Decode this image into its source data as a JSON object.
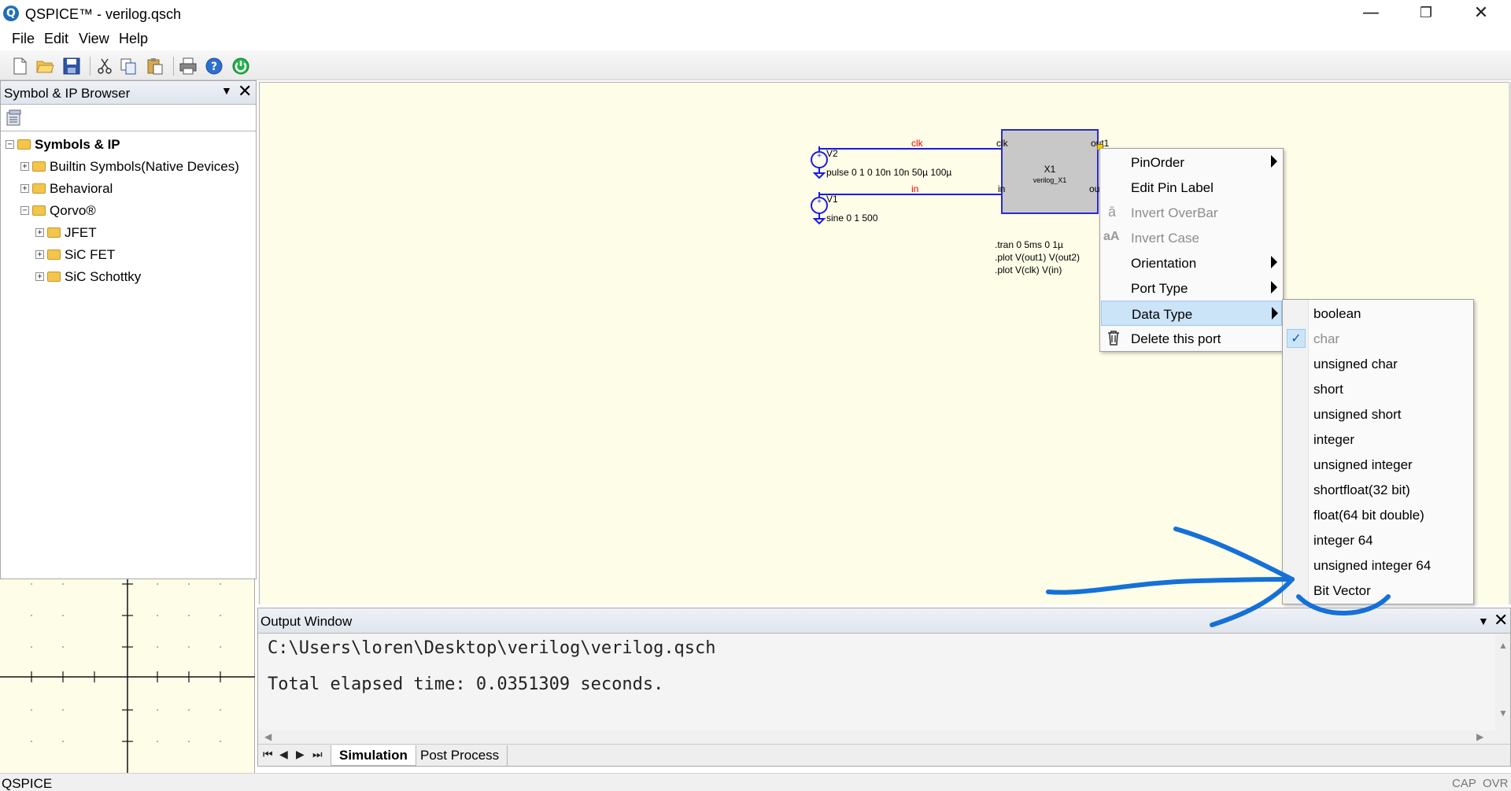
{
  "window": {
    "title": "QSPICE™ - verilog.qsch",
    "logo": "Q",
    "minimize": "—",
    "maximize": "❐",
    "close": "✕"
  },
  "menu": [
    "File",
    "Edit",
    "View",
    "Help"
  ],
  "toolbar": [
    "new-file-icon",
    "open-folder-icon",
    "save-icon",
    "cut-icon",
    "copy-icon",
    "paste-icon",
    "print-icon",
    "help-icon",
    "power-icon"
  ],
  "browser": {
    "title": "Symbol & IP Browser",
    "pin": "▼",
    "close": "✕",
    "tree": [
      {
        "label": "Symbols & IP",
        "exp": "−"
      },
      {
        "label": "Builtin Symbols(Native Devices)",
        "exp": "+"
      },
      {
        "label": "Behavioral",
        "exp": "+"
      },
      {
        "label": "Qorvo®",
        "exp": "−"
      },
      {
        "label": "JFET",
        "exp": "+"
      },
      {
        "label": "SiC FET",
        "exp": "+"
      },
      {
        "label": "SiC Schottky",
        "exp": "+"
      }
    ]
  },
  "schematic": {
    "v2_name": "V2",
    "v2_value": "pulse 0 1 0 10n 10n 50µ 100µ",
    "v1_name": "V1",
    "v1_value": "sine 0 1 500",
    "net_clk": "clk",
    "net_in": "in",
    "pin_clk": "clk",
    "pin_in": "in",
    "pin_out1": "out1",
    "pin_out": "ou",
    "component_name": "X1",
    "component_type": "verilog_X1",
    "directives": [
      ".tran 0 5ms 0 1µ",
      ".plot V(out1) V(out2)",
      ".plot V(clk) V(in)"
    ]
  },
  "context_menu": [
    {
      "label": "PinOrder",
      "submenu": true,
      "disabled": false
    },
    {
      "label": "Edit Pin Label",
      "submenu": false,
      "disabled": false
    },
    {
      "label": "Invert OverBar",
      "submenu": false,
      "disabled": true,
      "icon": "ā"
    },
    {
      "label": "Invert Case",
      "submenu": false,
      "disabled": true,
      "icon": "aA"
    },
    {
      "label": "Orientation",
      "submenu": true,
      "disabled": false
    },
    {
      "label": "Port Type",
      "submenu": true,
      "disabled": false
    },
    {
      "label": "Data Type",
      "submenu": true,
      "disabled": false,
      "highlighted": true
    },
    {
      "label": "Delete this port",
      "submenu": false,
      "disabled": false,
      "icon": "🗑"
    }
  ],
  "data_type_menu": {
    "selected": "char",
    "check": "✓",
    "items": [
      "boolean",
      "char",
      "unsigned char",
      "short",
      "unsigned short",
      "integer",
      "unsigned integer",
      "shortfloat(32 bit)",
      "float(64 bit double)",
      "integer 64",
      "unsigned integer 64",
      "Bit Vector"
    ]
  },
  "output": {
    "title": "Output Window",
    "pin": "▼",
    "close": "✕",
    "lines": [
      "C:\\Users\\loren\\Desktop\\verilog\\verilog.qsch",
      "Total elapsed time: 0.0351309 seconds."
    ],
    "tabs": [
      "Simulation",
      "Post Process"
    ],
    "active_tab": "Simulation"
  },
  "status": {
    "left": "QSPICE",
    "cap": "CAP",
    "ovr": "OVR"
  },
  "colors": {
    "schematic_bg": "#fdfde8",
    "wire": "#1a1ae6",
    "net_label": "#e00000",
    "menu_highlight": "#cce4f7",
    "annotation": "#1570d8"
  }
}
